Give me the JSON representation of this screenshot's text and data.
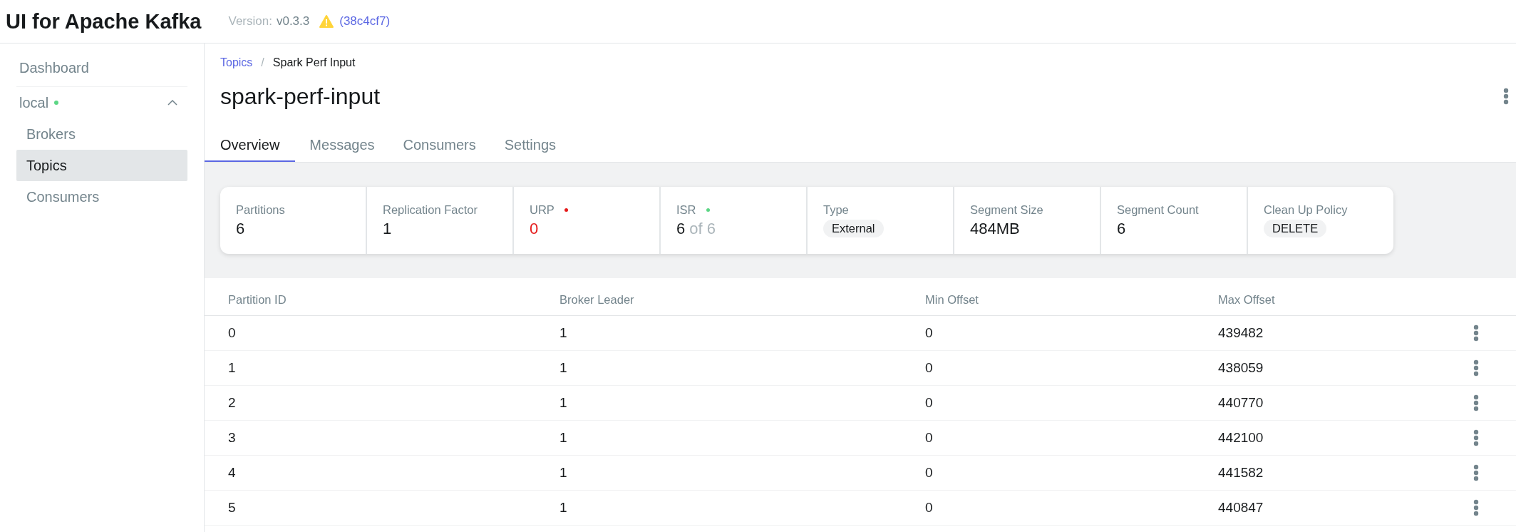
{
  "header": {
    "title": "UI for Apache Kafka",
    "version_label": "Version:",
    "version": "v0.3.3",
    "commit": "(38c4cf7)"
  },
  "sidebar": {
    "items": [
      {
        "label": "Dashboard",
        "selected": false
      }
    ],
    "clusters": [
      {
        "name": "local",
        "color": "#5cd685",
        "expanded": true,
        "children": [
          {
            "label": "Brokers",
            "selected": false
          },
          {
            "label": "Topics",
            "selected": true
          },
          {
            "label": "Consumers",
            "selected": false
          }
        ]
      }
    ]
  },
  "breadcrumb": {
    "parent": "Topics",
    "separator": "/",
    "current": "Spark Perf Input"
  },
  "title": "spark-perf-input",
  "tabs": [
    {
      "label": "Overview",
      "selected": true
    },
    {
      "label": "Messages",
      "selected": false
    },
    {
      "label": "Consumers",
      "selected": false
    },
    {
      "label": "Settings",
      "selected": false
    }
  ],
  "stats": [
    {
      "kind": "plain",
      "label": "Partitions",
      "value": "6"
    },
    {
      "kind": "plain",
      "label": "Replication Factor",
      "value": "1"
    },
    {
      "kind": "alert",
      "label": "URP",
      "value": "0",
      "color": "#e51a1a"
    },
    {
      "kind": "ratio",
      "label": "ISR",
      "value": "6",
      "suffix": "of 6",
      "color": "#5cd685"
    },
    {
      "kind": "tag",
      "label": "Type",
      "value": "External"
    },
    {
      "kind": "plain",
      "label": "Segment Size",
      "value": "484MB"
    },
    {
      "kind": "plain",
      "label": "Segment Count",
      "value": "6"
    },
    {
      "kind": "tag",
      "label": "Clean Up Policy",
      "value": "DELETE"
    }
  ],
  "table": {
    "columns": [
      "Partition ID",
      "Broker Leader",
      "Min Offset",
      "Max Offset"
    ],
    "rows": [
      [
        "0",
        "1",
        "0",
        "439482"
      ],
      [
        "1",
        "1",
        "0",
        "438059"
      ],
      [
        "2",
        "1",
        "0",
        "440770"
      ],
      [
        "3",
        "1",
        "0",
        "442100"
      ],
      [
        "4",
        "1",
        "0",
        "441582"
      ],
      [
        "5",
        "1",
        "0",
        "440847"
      ]
    ]
  }
}
